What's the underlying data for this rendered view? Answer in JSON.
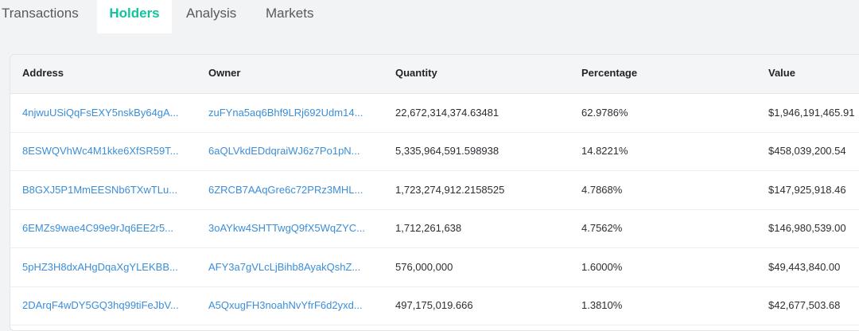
{
  "tabs": [
    {
      "label": "Transactions",
      "active": false
    },
    {
      "label": "Holders",
      "active": true
    },
    {
      "label": "Analysis",
      "active": false
    },
    {
      "label": "Markets",
      "active": false
    }
  ],
  "colors": {
    "accent": "#13c39a",
    "link": "#3b8ed8"
  },
  "table": {
    "headers": {
      "address": "Address",
      "owner": "Owner",
      "quantity": "Quantity",
      "percentage": "Percentage",
      "value": "Value"
    },
    "rows": [
      {
        "address": "4njwuUSiQqFsEXY5nskBy64gA...",
        "owner": "zuFYna5aq6Bhf9LRj692Udm14...",
        "quantity": "22,672,314,374.63481",
        "percentage": "62.9786%",
        "value": "$1,946,191,465.91"
      },
      {
        "address": "8ESWQVhWc4M1kke6XfSR59T...",
        "owner": "6aQLVkdEDdqraiWJ6z7Po1pN...",
        "quantity": "5,335,964,591.598938",
        "percentage": "14.8221%",
        "value": "$458,039,200.54"
      },
      {
        "address": "B8GXJ5P1MmEESNb6TXwTLu...",
        "owner": "6ZRCB7AAqGre6c72PRz3MHL...",
        "quantity": "1,723,274,912.2158525",
        "percentage": "4.7868%",
        "value": "$147,925,918.46"
      },
      {
        "address": "6EMZs9wae4C99e9rJq6EE2r5...",
        "owner": "3oAYkw4SHTTwgQ9fX5WqZYC...",
        "quantity": "1,712,261,638",
        "percentage": "4.7562%",
        "value": "$146,980,539.00"
      },
      {
        "address": "5pHZ3H8dxAHgDqaXgYLEKBB...",
        "owner": "AFY3a7gVLcLjBihb8AyakQshZ...",
        "quantity": "576,000,000",
        "percentage": "1.6000%",
        "value": "$49,443,840.00"
      },
      {
        "address": "2DArqF4wDY5GQ3hq99tiFeJbV...",
        "owner": "A5QxugFH3noahNvYfrF6d2yxd...",
        "quantity": "497,175,019.666",
        "percentage": "1.3810%",
        "value": "$42,677,503.68"
      }
    ]
  }
}
